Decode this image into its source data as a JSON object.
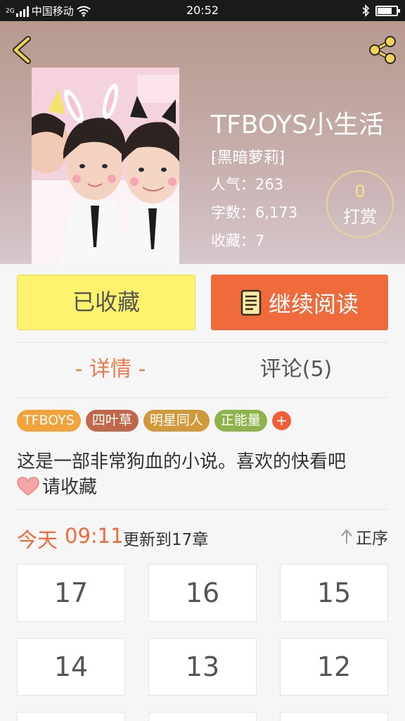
{
  "status_bar": {
    "carrier": "中国移动",
    "network": "2G",
    "time": "20:52"
  },
  "book": {
    "title": "TFBOYS小生活",
    "author": "⁅黑暗萝莉⁆",
    "popularity": "人气：263",
    "word_count": "字数：6,173",
    "favorites": "收藏：7",
    "reward_count": "0",
    "reward_label": "打赏"
  },
  "actions": {
    "favorited_label": "已收藏",
    "continue_label": "继续阅读"
  },
  "tabs": {
    "detail": "- 详情 -",
    "comments": "评论(5)"
  },
  "tags": [
    {
      "label": "TFBOYS",
      "color": "#f3a33b"
    },
    {
      "label": "四叶草",
      "color": "#c0684c"
    },
    {
      "label": "明星同人",
      "color": "#d0993c"
    },
    {
      "label": "正能量",
      "color": "#8fb34c"
    }
  ],
  "tag_add": "+",
  "description": {
    "line1": "这是一部非常狗血的小说。喜欢的快看吧",
    "line2": "请收藏"
  },
  "update": {
    "day": "今天",
    "time": "09:11",
    "text": "更新到17章",
    "sort_label": "正序"
  },
  "chapters": [
    "17",
    "16",
    "15",
    "14",
    "13",
    "12"
  ],
  "colors": {
    "accent": "#ef6b3b",
    "favorite_button": "#fff36e",
    "reward_count": "#f3e28a"
  },
  "icons": {
    "back": "chevron-left-icon",
    "share": "share-icon",
    "book": "book-icon",
    "heart": "heart-icon",
    "sort": "arrow-up-icon"
  }
}
